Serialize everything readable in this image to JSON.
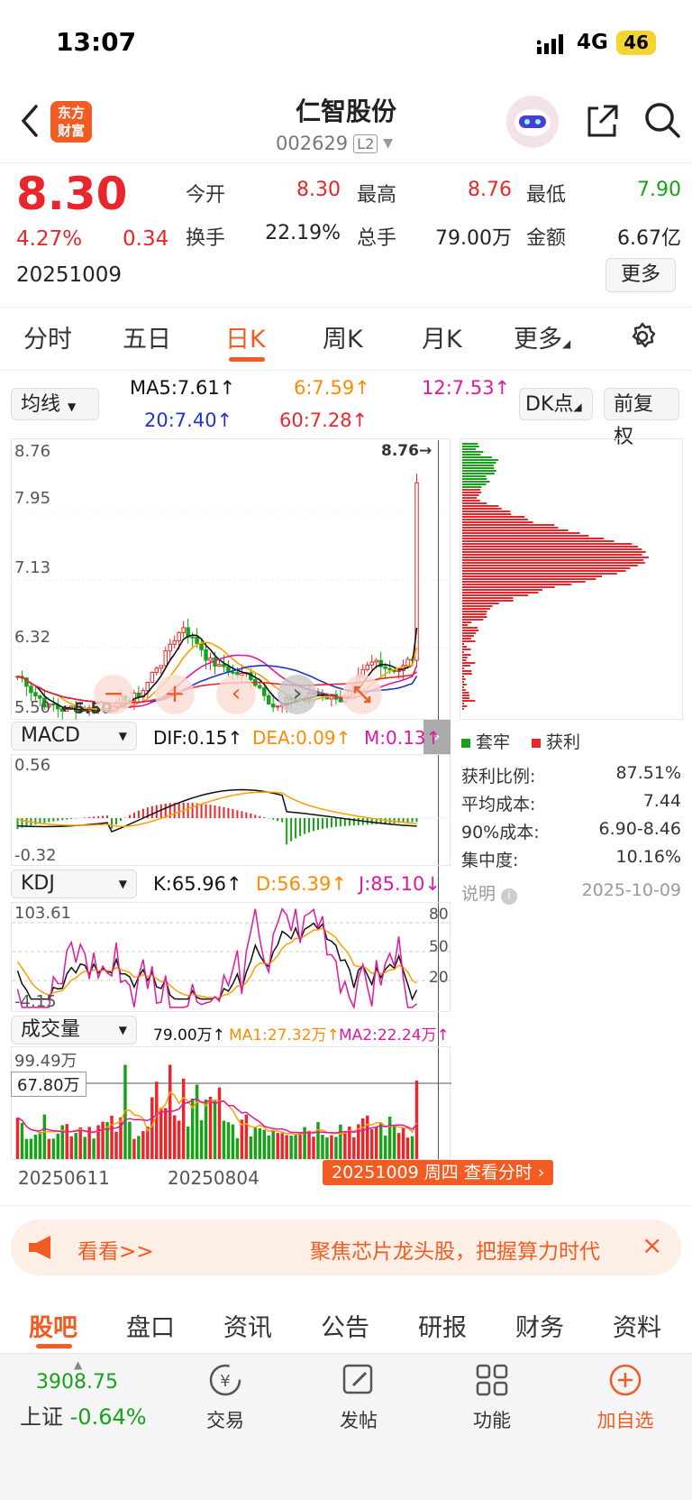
{
  "status": {
    "time": "13:07",
    "network": "4G",
    "battery": "46"
  },
  "header": {
    "logo_line1": "东方",
    "logo_line2": "财富",
    "title": "仁智股份",
    "code": "002629",
    "badge": "L2"
  },
  "quote": {
    "price": "8.30",
    "change_pct": "4.27%",
    "change": "0.34",
    "date": "20251009",
    "open_label": "今开",
    "open": "8.30",
    "high_label": "最高",
    "high": "8.76",
    "low_label": "最低",
    "low": "7.90",
    "turnover_label": "换手",
    "turnover": "22.19%",
    "volume_label": "总手",
    "volume": "79.00万",
    "amount_label": "金额",
    "amount": "6.67亿",
    "more": "更多"
  },
  "tabs": [
    "分时",
    "五日",
    "日K",
    "周K",
    "月K",
    "更多"
  ],
  "ma_bar": {
    "select": "均线",
    "ma5": "MA5:7.61↑",
    "ma10": "6:7.59↑",
    "ma12": "12:7.53↑",
    "ma20": "20:7.40↑",
    "ma60": "60:7.28↑",
    "dk": "DK点",
    "fq": "前复权"
  },
  "kchart": {
    "high_label": "8.76",
    "y2": "7.95",
    "y3": "7.13",
    "y4": "6.32",
    "y5": "5.50",
    "max_mark": "8.76→",
    "min_mark": "←5.50",
    "signals": [
      "1",
      "2",
      "3",
      "4",
      "5",
      "6",
      "7",
      "8",
      "9",
      "1",
      "2",
      "3",
      "4",
      "5",
      "6",
      "7",
      "8",
      "9"
    ]
  },
  "chips": {
    "legend_hold": "套牢",
    "legend_profit": "获利",
    "rows": [
      {
        "label": "获利比例:",
        "value": "87.51%"
      },
      {
        "label": "平均成本:",
        "value": "7.44"
      },
      {
        "label": "90%成本:",
        "value": "6.90-8.46"
      },
      {
        "label": "集中度:",
        "value": "10.16%"
      }
    ],
    "note_label": "说明",
    "note_date": "2025-10-09"
  },
  "macd": {
    "select": "MACD",
    "dif": "DIF:0.15↑",
    "dea": "DEA:0.09↑",
    "m": "M:0.13↑",
    "top": "0.56",
    "bottom": "-0.32"
  },
  "kdj": {
    "select": "KDJ",
    "k": "K:65.96↑",
    "d": "D:56.39↑",
    "j": "J:85.10↓",
    "top": "103.61",
    "bottom": "-4.15",
    "l80": "80",
    "l50": "50",
    "l20": "20"
  },
  "vol": {
    "select": "成交量",
    "v": "79.00万↑",
    "ma1": "MA1:27.32万↑",
    "ma2": "MA2:22.24万↑",
    "top": "99.49万",
    "cursor": "67.80万"
  },
  "dates": {
    "d1": "20250611",
    "d2": "20250804",
    "tooltip": "20251009 周四 查看分时"
  },
  "banner": {
    "left": "看看>>",
    "text": "聚焦芯片龙头股，把握算力时代"
  },
  "sections": [
    "股吧",
    "盘口",
    "资讯",
    "公告",
    "研报",
    "财务",
    "资料"
  ],
  "bottom": {
    "index_value": "3908.75",
    "index_name": "上证",
    "index_change": "-0.64%",
    "trade": "交易",
    "post": "发帖",
    "func": "功能",
    "add": "加自选"
  },
  "colors": {
    "red": "#e8262b",
    "green": "#17a217",
    "accent": "#f25c22"
  }
}
